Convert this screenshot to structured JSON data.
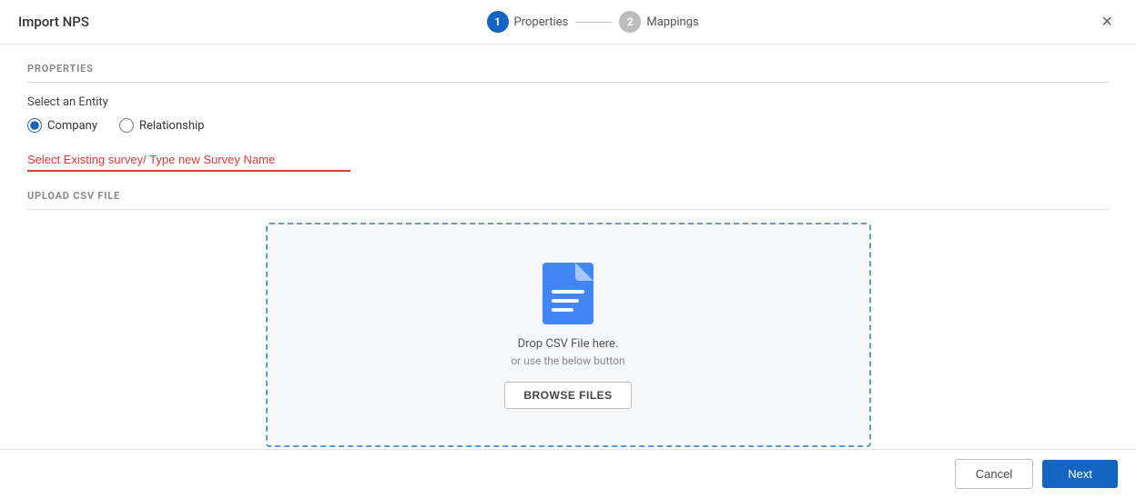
{
  "header": {
    "title": "Import NPS",
    "close_icon": "×"
  },
  "stepper": {
    "steps": [
      {
        "number": "1",
        "label": "Properties",
        "active": true
      },
      {
        "number": "2",
        "label": "Mappings",
        "active": false
      }
    ]
  },
  "properties_section": {
    "title": "PROPERTIES",
    "entity_label": "Select an Entity",
    "radio_options": [
      {
        "id": "company",
        "label": "Company",
        "checked": true
      },
      {
        "id": "relationship",
        "label": "Relationship",
        "checked": false
      }
    ],
    "survey_placeholder": "Select Existing survey/ Type new Survey Name"
  },
  "upload_section": {
    "title": "UPLOAD CSV FILE",
    "drop_text_main": "Drop CSV File here.",
    "drop_text_sub": "or use the below button",
    "browse_label": "BROWSE FILES"
  },
  "footer": {
    "cancel_label": "Cancel",
    "next_label": "Next"
  }
}
